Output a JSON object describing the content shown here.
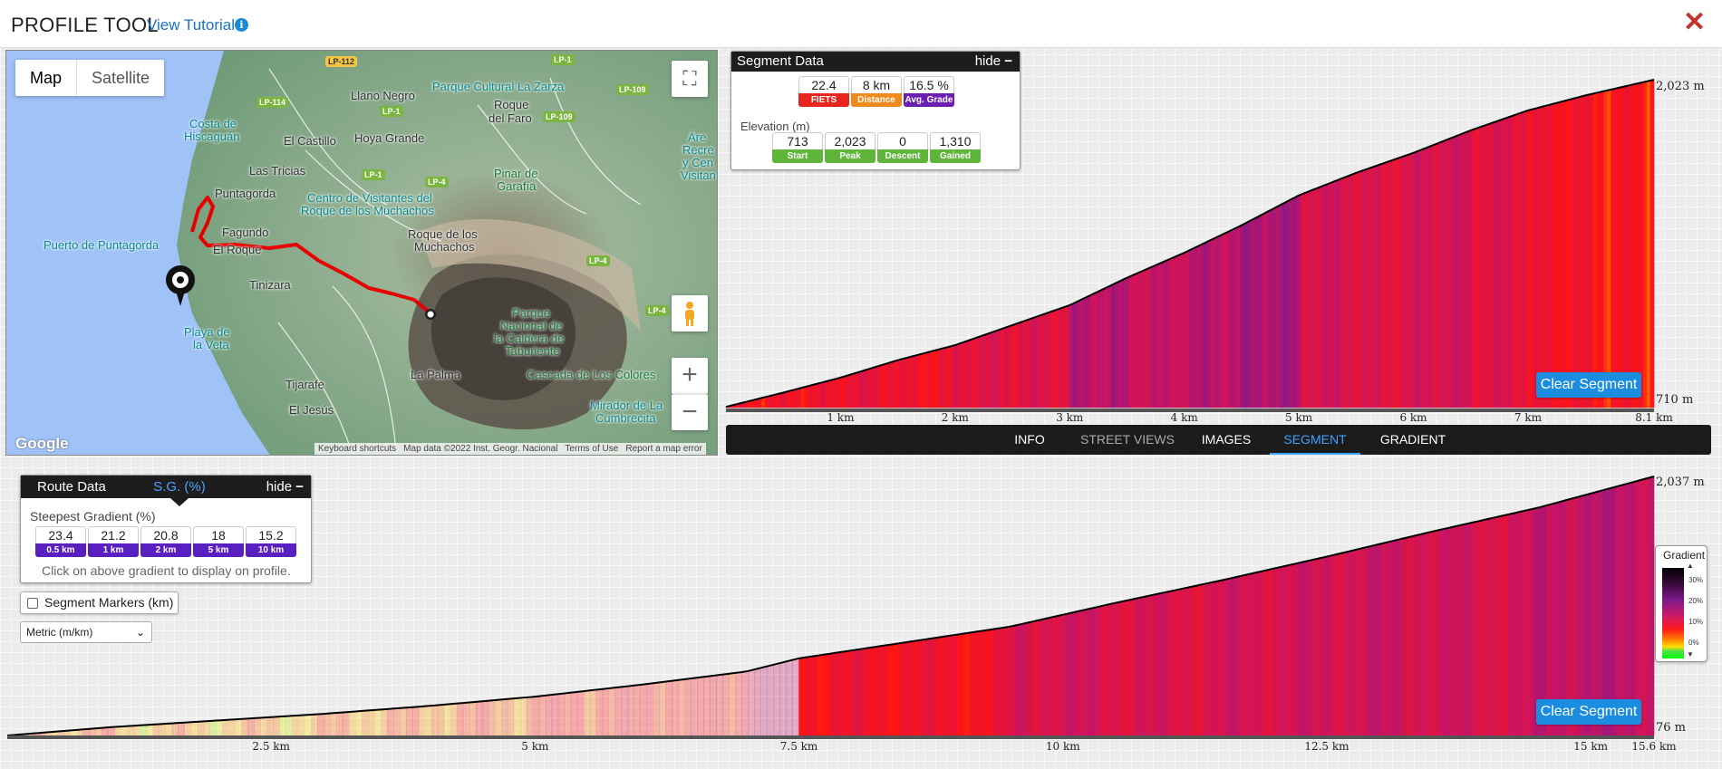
{
  "title": "PROFILE TOOL",
  "tutorial_link": "View Tutorial",
  "map": {
    "type_buttons": {
      "map": "Map",
      "satellite": "Satellite"
    },
    "places": [
      {
        "id": "parque-cultural",
        "text": "Parque Cultural La Zarza",
        "style": "teal"
      },
      {
        "id": "llano-negro",
        "text": "Llano Negro",
        "style": ""
      },
      {
        "id": "roque-faro-1",
        "text": "Roque",
        "style": ""
      },
      {
        "id": "roque-faro-2",
        "text": "del Faro",
        "style": ""
      },
      {
        "id": "costa-1",
        "text": "Costa de",
        "style": "teal"
      },
      {
        "id": "costa-2",
        "text": "Hiscaguán",
        "style": "teal"
      },
      {
        "id": "el-castillo",
        "text": "El Castillo",
        "style": ""
      },
      {
        "id": "hoya-grande",
        "text": "Hoya Grande",
        "style": ""
      },
      {
        "id": "las-tricias",
        "text": "Las Tricias",
        "style": ""
      },
      {
        "id": "pinar-1",
        "text": "Pinar de",
        "style": "green"
      },
      {
        "id": "pinar-2",
        "text": "Garafía",
        "style": "green"
      },
      {
        "id": "puntagorda",
        "text": "Puntagorda",
        "style": ""
      },
      {
        "id": "centro-1",
        "text": "Centro de Visitantes del",
        "style": "teal"
      },
      {
        "id": "centro-2",
        "text": "Roque de los Muchachos",
        "style": "teal"
      },
      {
        "id": "puerto",
        "text": "Puerto de Puntagorda",
        "style": "teal"
      },
      {
        "id": "fagundo",
        "text": "Fagundo",
        "style": ""
      },
      {
        "id": "el-roque",
        "text": "El Roque",
        "style": ""
      },
      {
        "id": "roque-m-1",
        "text": "Roque de los",
        "style": ""
      },
      {
        "id": "roque-m-2",
        "text": "Muchachos",
        "style": ""
      },
      {
        "id": "tinizara",
        "text": "Tinizara",
        "style": ""
      },
      {
        "id": "playa-1",
        "text": "Playa de",
        "style": "teal"
      },
      {
        "id": "playa-2",
        "text": "la Veta",
        "style": "teal"
      },
      {
        "id": "parque-nac-1",
        "text": "Parque",
        "style": "green"
      },
      {
        "id": "parque-nac-2",
        "text": "Nacional de",
        "style": "green"
      },
      {
        "id": "parque-nac-3",
        "text": "la Caldera de",
        "style": "green"
      },
      {
        "id": "parque-nac-4",
        "text": "Taburiente",
        "style": "green"
      },
      {
        "id": "tijarafe",
        "text": "Tijarafe",
        "style": ""
      },
      {
        "id": "la-palma",
        "text": "La Palma",
        "style": ""
      },
      {
        "id": "cascada",
        "text": "Cascada de Los Colores",
        "style": "green"
      },
      {
        "id": "el-jesus",
        "text": "El Jesús",
        "style": ""
      },
      {
        "id": "mirador-1",
        "text": "Mirador de La",
        "style": "teal"
      },
      {
        "id": "mirador-2",
        "text": "Cumbrecita",
        "style": "teal"
      },
      {
        "id": "arec-1",
        "text": "Áre",
        "style": "teal"
      },
      {
        "id": "arec-2",
        "text": "Recre",
        "style": "teal"
      },
      {
        "id": "arec-3",
        "text": "y Cen",
        "style": "teal"
      },
      {
        "id": "arec-4",
        "text": "Visitan",
        "style": "teal"
      }
    ],
    "roads": [
      "LP-112",
      "LP-1",
      "LP-109",
      "LP-114",
      "LP-1",
      "LP-109",
      "LP-1",
      "LP-4",
      "LP-4",
      "LP-4"
    ],
    "google": "Google",
    "attribution": [
      "Keyboard shortcuts",
      "Map data ©2022 Inst. Geogr. Nacional",
      "Terms of Use",
      "Report a map error"
    ]
  },
  "segment_data": {
    "heading": "Segment Data",
    "hide": "hide",
    "fiets": {
      "value": "22.4",
      "label": "FIETS"
    },
    "distance": {
      "value": "8 km",
      "label": "Distance"
    },
    "avg_grade": {
      "value": "16.5 %",
      "label": "Avg. Grade"
    },
    "elevation_label": "Elevation (m)",
    "start": {
      "value": "713",
      "label": "Start"
    },
    "peak": {
      "value": "2,023",
      "label": "Peak"
    },
    "descent": {
      "value": "0",
      "label": "Descent"
    },
    "gained": {
      "value": "1,310",
      "label": "Gained"
    }
  },
  "tabs": [
    "INFO",
    "STREET VIEWS",
    "IMAGES",
    "SEGMENT",
    "GRADIENT"
  ],
  "active_tab": "SEGMENT",
  "segment_profile": {
    "top_label": "2,023 m",
    "bottom_label": "710 m",
    "km_ticks": [
      "1 km",
      "2 km",
      "3 km",
      "4 km",
      "5 km",
      "6 km",
      "7 km",
      "8.1 km"
    ],
    "clear_button": "Clear Segment"
  },
  "route_data": {
    "tab_route": "Route Data",
    "tab_sg": "S.G. (%)",
    "hide": "hide",
    "steepest_label": "Steepest Gradient (%)",
    "gradients": [
      {
        "value": "23.4",
        "label": "0.5 km"
      },
      {
        "value": "21.2",
        "label": "1 km"
      },
      {
        "value": "20.8",
        "label": "2 km"
      },
      {
        "value": "18",
        "label": "5 km"
      },
      {
        "value": "15.2",
        "label": "10 km"
      }
    ],
    "hint": "Click on above gradient to display on profile."
  },
  "segment_markers": "Segment Markers (km)",
  "units_select": "Metric (m/km)",
  "full_profile": {
    "top_label": "2,037 m",
    "bottom_label": "76 m",
    "km_ticks": [
      "2.5 km",
      "5 km",
      "7.5 km",
      "10 km",
      "12.5 km",
      "15 km",
      "15.6 km"
    ],
    "clear_button": "Clear Segment"
  },
  "legend": {
    "title": "Gradient",
    "ticks": [
      "30%",
      "20%",
      "10%",
      "0%"
    ]
  },
  "colors": {
    "fiets": "#e8251f",
    "distance": "#f08a1c",
    "avg_grade": "#6a1fb0",
    "elevation": "#5fb43a",
    "steep": "#5a1fc0",
    "accent": "#1a8de0"
  },
  "chart_data": [
    {
      "type": "area",
      "title": "",
      "x": [
        0,
        0.5,
        1,
        1.5,
        2,
        2.5,
        3,
        3.5,
        4,
        4.5,
        5,
        5.5,
        6,
        6.5,
        7,
        7.5,
        8.1
      ],
      "y": [
        713,
        770,
        830,
        900,
        960,
        1040,
        1120,
        1230,
        1330,
        1440,
        1560,
        1650,
        1730,
        1820,
        1900,
        1960,
        2023
      ],
      "xlabel": "km",
      "ylim": [
        710,
        2023
      ]
    },
    {
      "type": "area",
      "title": "",
      "x": [
        0,
        1,
        2,
        3,
        4,
        5,
        6,
        7,
        7.5,
        8.5,
        9.5,
        10.5,
        11.5,
        12.5,
        13.5,
        14.5,
        15.6
      ],
      "y": [
        76,
        140,
        190,
        240,
        300,
        370,
        460,
        560,
        660,
        780,
        900,
        1080,
        1250,
        1430,
        1620,
        1800,
        2037
      ],
      "xlabel": "km",
      "ylim": [
        76,
        2037
      ]
    }
  ]
}
